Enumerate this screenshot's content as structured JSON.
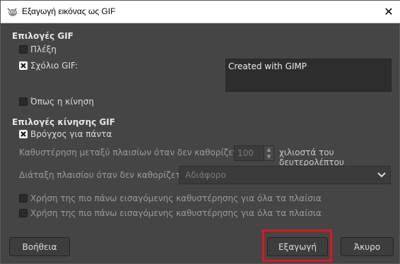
{
  "window": {
    "title": "Εξαγωγή εικόνας ως GIF"
  },
  "gif_options": {
    "heading": "Επιλογές GIF",
    "interlace_label": "Πλέξη",
    "comment_label": "Σχόλιο GIF:",
    "comment_value": "Created with GIMP",
    "as_animation_label": "Όπως η κίνηση",
    "interlace_checked": false,
    "comment_checked": true,
    "as_animation_checked": false
  },
  "animation_options": {
    "heading": "Επιλογές κίνησης GIF",
    "loop_label": "Βρόγχος για πάντα",
    "loop_checked": true,
    "delay_label": "Καθυστέρηση μεταξύ πλαισίων όταν δεν καθορίζεται:",
    "delay_value": "100",
    "delay_unit": "χιλιοστά του δευτερολέπτου",
    "disposal_label": "Διάταξη πλαισίου όταν δεν καθορίζεται:",
    "disposal_value": "Αδιάφορο",
    "use_delay_label": "Χρήση της πιο πάνω εισαγόμενης καθυστέρησης για όλα τα πλαίσια",
    "use_disposal_label": "Χρήση της πιο πάνω εισαγόμενης καθυστέρησης για όλα τα πλαίσια"
  },
  "buttons": {
    "help": "Βοήθεια",
    "export": "Εξαγωγή",
    "cancel": "Άκυρο"
  },
  "colors": {
    "highlight": "#e0161c",
    "background": "#454545"
  }
}
